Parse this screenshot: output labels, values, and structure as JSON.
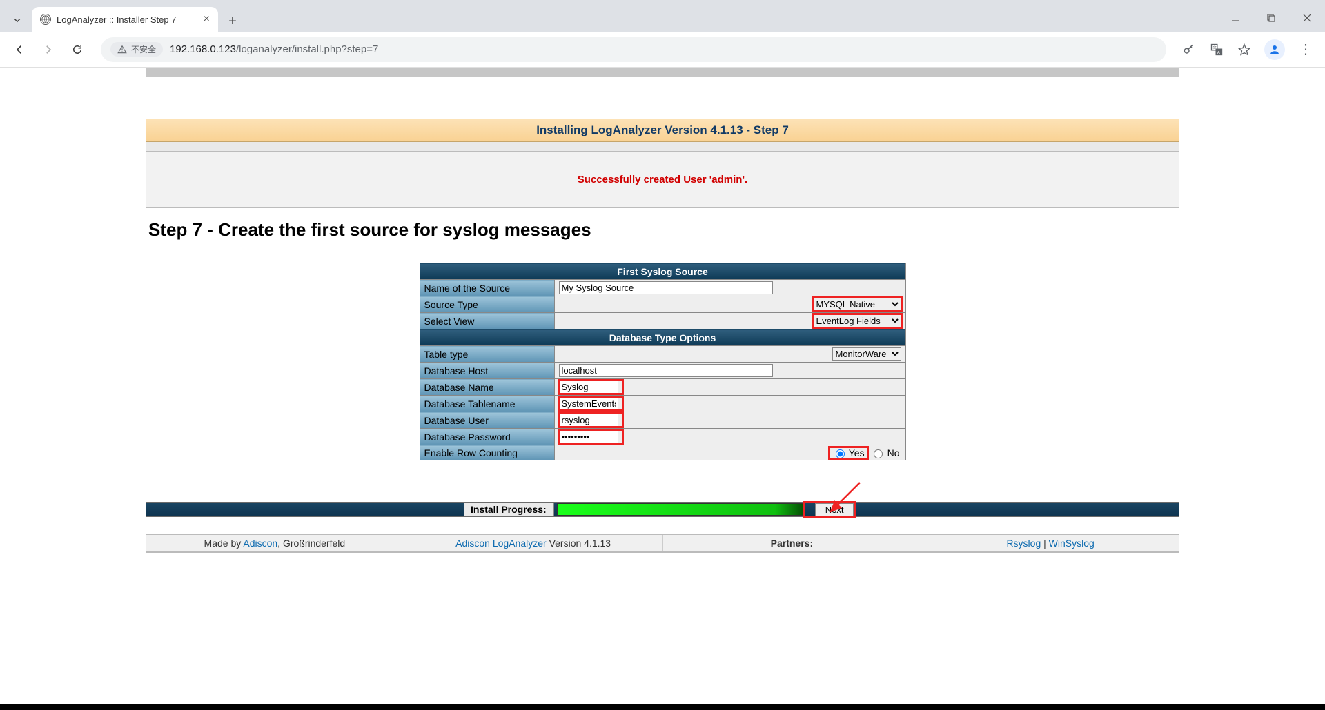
{
  "browser": {
    "tab_title": "LogAnalyzer :: Installer Step 7",
    "security_label": "不安全",
    "url": "192.168.0.123/loganalyzer/install.php?step=7",
    "url_dim": "/loganalyzer/install.php?step=7",
    "url_host": "192.168.0.123"
  },
  "page": {
    "banner": "Installing LogAnalyzer Version 4.1.13 - Step 7",
    "status": "Successfully created User 'admin'.",
    "step_title": "Step 7 - Create the first source for syslog messages",
    "section1": "First Syslog Source",
    "section2": "Database Type Options",
    "labels": {
      "name": "Name of the Source",
      "source_type": "Source Type",
      "select_view": "Select View",
      "table_type": "Table type",
      "db_host": "Database Host",
      "db_name": "Database Name",
      "db_table": "Database Tablename",
      "db_user": "Database User",
      "db_pass": "Database Password",
      "row_count": "Enable Row Counting"
    },
    "values": {
      "name": "My Syslog Source",
      "source_type": "MYSQL Native",
      "select_view": "EventLog Fields",
      "table_type": "MonitorWare",
      "db_host": "localhost",
      "db_name": "Syslog",
      "db_table": "SystemEvents",
      "db_user": "rsyslog",
      "db_pass": "•••••••••",
      "row_yes": "Yes",
      "row_no": "No"
    },
    "progress_label": "Install Progress:",
    "next": "Next"
  },
  "footer": {
    "made_by_prefix": "Made by ",
    "adiscon": "Adiscon",
    "location": ", Großrinderfeld",
    "product": "Adiscon LogAnalyzer",
    "version": " Version 4.1.13",
    "partners": "Partners:",
    "rsyslog": "Rsyslog",
    "sep": "  |  ",
    "winsyslog": "WinSyslog"
  }
}
